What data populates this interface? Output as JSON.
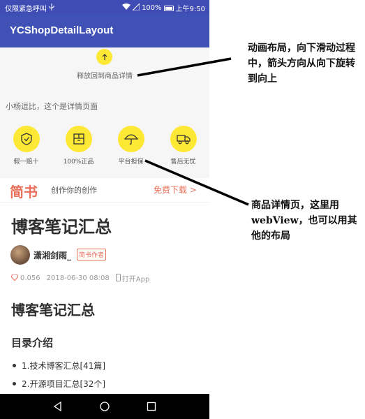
{
  "status_bar": {
    "left_text": "仅限紧急呼叫",
    "battery": "100%",
    "time": "上午9:50"
  },
  "app_bar": {
    "title": "YCShopDetailLayout"
  },
  "pull": {
    "text": "释放回到商品详情",
    "icon": "arrow-up-icon"
  },
  "detail": {
    "text": "小杨逗比，这个是详情页面",
    "features": [
      {
        "label": "假一赔十",
        "icon": "shield-check-icon"
      },
      {
        "label": "100%正品",
        "icon": "box-icon"
      },
      {
        "label": "平台担保",
        "icon": "umbrella-icon"
      },
      {
        "label": "售后无忧",
        "icon": "truck-icon"
      }
    ]
  },
  "jianshu": {
    "logo": "简书",
    "slogan": "创作你的创作",
    "download": "免费下载 >"
  },
  "article": {
    "title": "博客笔记汇总",
    "author": "潇湘剑雨_",
    "badge": "简书作者",
    "diamonds": "0.056",
    "date": "2018-06-30 08:08",
    "open_app": "打开App",
    "h2": "博客笔记汇总",
    "h3": "目录介绍",
    "toc": [
      "1.技术博客汇总[41篇]",
      "2.开源项目汇总[32个]"
    ]
  },
  "annotations": {
    "note1": "动画布局，向下滑动过程中，箭头方向从向下旋转到向上",
    "note2": "商品详情页，这里用webView，也可以用其他的布局"
  },
  "colors": {
    "primary": "#3f51b5",
    "accent_yellow": "#fde935",
    "jianshu_red": "#ea6f5a"
  }
}
